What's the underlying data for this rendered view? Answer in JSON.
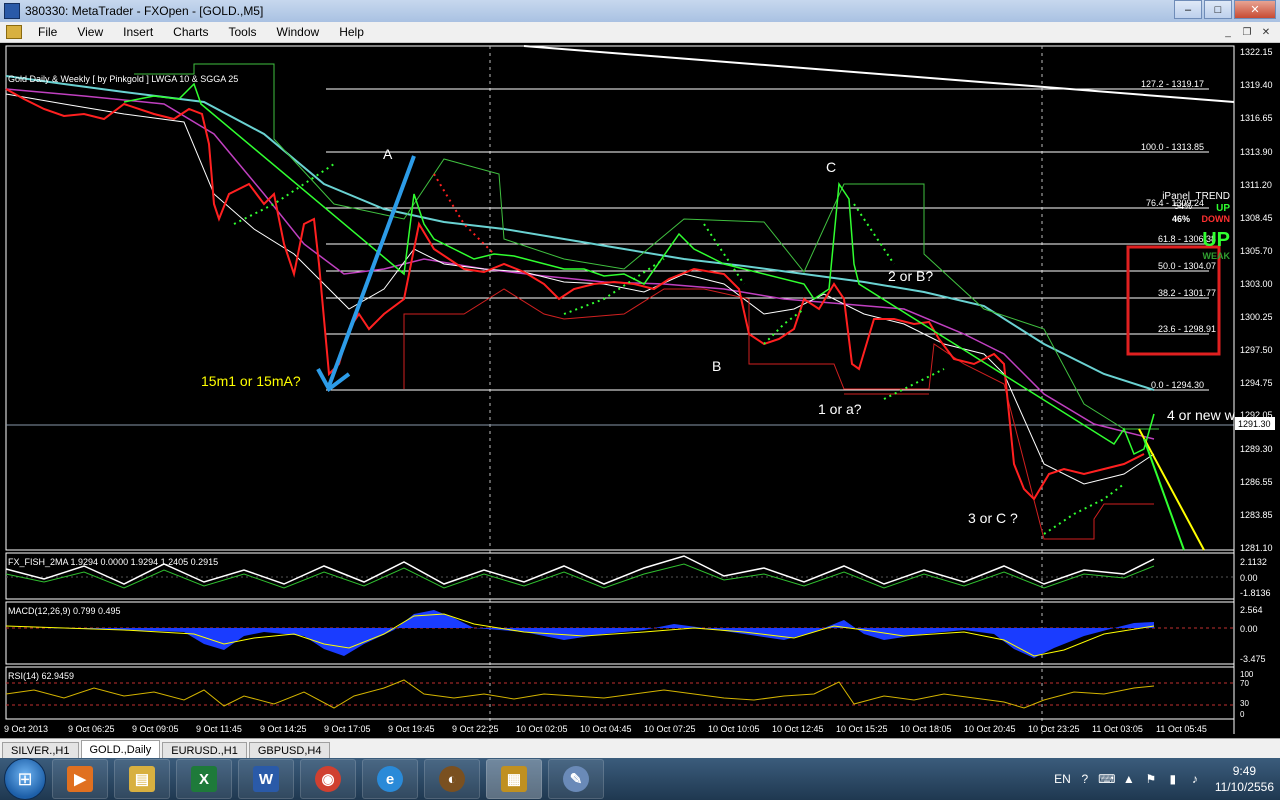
{
  "window": {
    "title": "380330: MetaTrader - FXOpen - [GOLD.,M5]",
    "minimize": "–",
    "maximize": "□",
    "close": "✕"
  },
  "menu": [
    "File",
    "View",
    "Insert",
    "Charts",
    "Tools",
    "Window",
    "Help"
  ],
  "mdi": {
    "minimize": "_",
    "restore": "❐",
    "close": "✕"
  },
  "chart": {
    "indicator_label": "Gold Daily & Weekly [ by Pinkgold ]  LWGA 10  &  SGGA 25",
    "current_price": "1291.30",
    "price_ticks": [
      "1322.15",
      "1319.40",
      "1316.65",
      "1313.90",
      "1311.20",
      "1308.45",
      "1305.70",
      "1303.00",
      "1300.25",
      "1297.50",
      "1294.75",
      "1292.05",
      "1289.30",
      "1286.55",
      "1283.85",
      "1281.10"
    ],
    "fib_levels": [
      "127.2 - 1319.17",
      "100.0 - 1313.85",
      "76.4 - 1309.24",
      "61.8 - 1306.38",
      "50.0 - 1304.07",
      "38.2 - 1301.77",
      "23.6 - 1298.91",
      "0.0 - 1294.30"
    ],
    "time_ticks": [
      "9 Oct 2013",
      "9 Oct 06:25",
      "9 Oct 09:05",
      "9 Oct 11:45",
      "9 Oct 14:25",
      "9 Oct 17:05",
      "9 Oct 19:45",
      "9 Oct 22:25",
      "10 Oct 02:05",
      "10 Oct 04:45",
      "10 Oct 07:25",
      "10 Oct 10:05",
      "10 Oct 12:45",
      "10 Oct 15:25",
      "10 Oct 18:05",
      "10 Oct 20:45",
      "10 Oct 23:25",
      "11 Oct 03:05",
      "11 Oct 05:45"
    ],
    "annotations": {
      "a": "A",
      "b": "B",
      "c": "C",
      "wave_15m": "15m1 or 15mA?",
      "wave_1a": "1 or a?",
      "wave_2b": "2 or B?",
      "wave_3c": "3 or C ?",
      "wave_4": "4 or new w"
    },
    "ipanel": {
      "title": "iPanel_TREND",
      "pct_label": "54%",
      "up_small": "UP",
      "pct2": "46%",
      "down": "DOWN",
      "big_up": "UP",
      "weak": "WEAK"
    }
  },
  "subwindows": {
    "fish": {
      "label": "FX_FISH_2MA 1.9294 0.0000 1.9294 1.2405 0.2915",
      "ticks": [
        "2.1132",
        "0.00",
        "-1.8136"
      ]
    },
    "macd": {
      "label": "MACD(12,26,9) 0.799 0.495",
      "ticks": [
        "2.564",
        "0.00",
        "-3.475"
      ]
    },
    "rsi": {
      "label": "RSI(14) 62.9459",
      "ticks": [
        "100",
        "70",
        "30",
        "0"
      ]
    }
  },
  "tabs": [
    {
      "label": "SILVER.,H1",
      "active": false
    },
    {
      "label": "GOLD.,Daily",
      "active": true
    },
    {
      "label": "EURUSD.,H1",
      "active": false
    },
    {
      "label": "GBPUSD,H4",
      "active": false
    }
  ],
  "taskbar": {
    "apps": [
      {
        "name": "media-player",
        "color": "#e07020",
        "glyph": "▶",
        "active": false
      },
      {
        "name": "file-explorer",
        "color": "#d8b040",
        "glyph": "▤",
        "active": false
      },
      {
        "name": "excel",
        "color": "#1e7a3a",
        "glyph": "X",
        "active": false
      },
      {
        "name": "word",
        "color": "#2a5aa8",
        "glyph": "W",
        "active": false
      },
      {
        "name": "chrome",
        "color": "#d04030",
        "glyph": "◉",
        "active": false
      },
      {
        "name": "internet-explorer",
        "color": "#2a8ad8",
        "glyph": "e",
        "active": false
      },
      {
        "name": "gold-app",
        "color": "#7a5020",
        "glyph": "◐",
        "active": false
      },
      {
        "name": "metatrader",
        "color": "#c09020",
        "glyph": "▦",
        "active": true
      },
      {
        "name": "paint",
        "color": "#6a8ab8",
        "glyph": "✎",
        "active": false
      }
    ],
    "lang": "EN",
    "time": "9:49",
    "date": "11/10/2556"
  }
}
